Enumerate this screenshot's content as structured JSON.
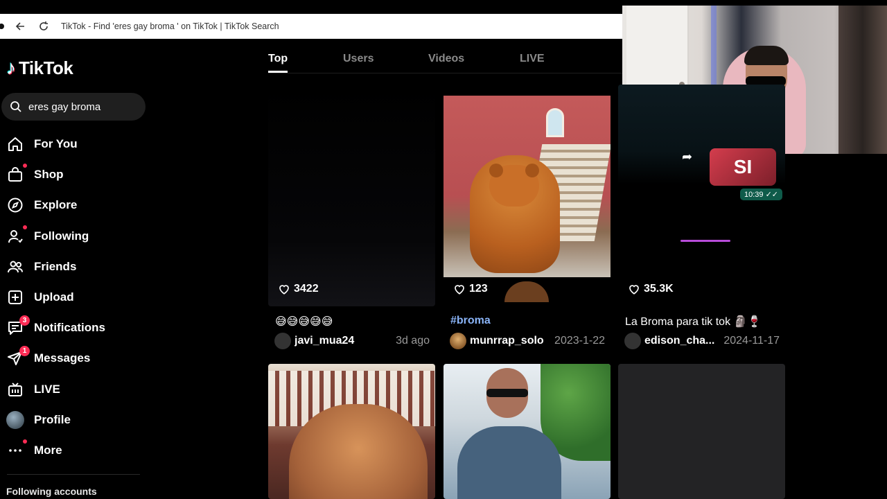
{
  "browser": {
    "title": "TikTok - Find 'eres gay broma ' on TikTok | TikTok Search"
  },
  "sidebar": {
    "logo_text": "TikTok",
    "search_value": "eres gay broma",
    "items": [
      {
        "label": "For You",
        "icon": "home-icon"
      },
      {
        "label": "Shop",
        "icon": "shopping-bag-icon"
      },
      {
        "label": "Explore",
        "icon": "compass-icon"
      },
      {
        "label": "Following",
        "icon": "following-icon"
      },
      {
        "label": "Friends",
        "icon": "friends-icon"
      },
      {
        "label": "Upload",
        "icon": "upload-icon"
      },
      {
        "label": "Notifications",
        "icon": "notifications-icon",
        "badge": "3"
      },
      {
        "label": "Messages",
        "icon": "messages-icon",
        "badge": "1"
      },
      {
        "label": "LIVE",
        "icon": "live-icon"
      },
      {
        "label": "Profile",
        "icon": "avatar"
      },
      {
        "label": "More",
        "icon": "more-icon"
      }
    ],
    "following_accounts": "Following accounts"
  },
  "tabs": [
    "Top",
    "Users",
    "Videos",
    "LIVE"
  ],
  "videos": [
    {
      "likes": "3422",
      "caption": "😅😅😅😅😅",
      "user": "javi_mua24",
      "date": "3d ago"
    },
    {
      "likes": "123",
      "caption": "#broma",
      "user": "munrrap_solo",
      "date": "2023-1-22"
    },
    {
      "likes": "35.3K",
      "caption": "La Broma para tik tok 🗿🍷",
      "user": "edison_cha...",
      "date": "2024-11-17"
    }
  ],
  "chat_overlay": {
    "sticker_text": "SI",
    "time": "10:39 ✓✓"
  },
  "colors": {
    "accent": "#fe2c55",
    "tiktok_cyan": "#25f4ee",
    "background": "#000000"
  }
}
